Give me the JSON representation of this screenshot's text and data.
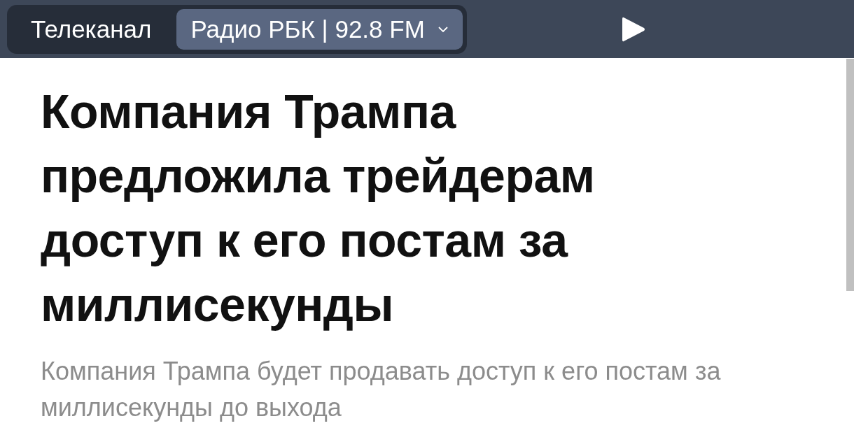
{
  "top_bar": {
    "tabs": [
      {
        "label": "Телеканал",
        "selected": false,
        "kind": "plain"
      },
      {
        "label": "Радио РБК | 92.8 FM",
        "selected": true,
        "kind": "dropdown"
      }
    ]
  },
  "article": {
    "headline": "Компания Трампа предложила трейдерам доступ к его постам за миллисекунды",
    "lead": "Компания Трампа будет продавать доступ к его постам за миллисекунды до выхода"
  }
}
